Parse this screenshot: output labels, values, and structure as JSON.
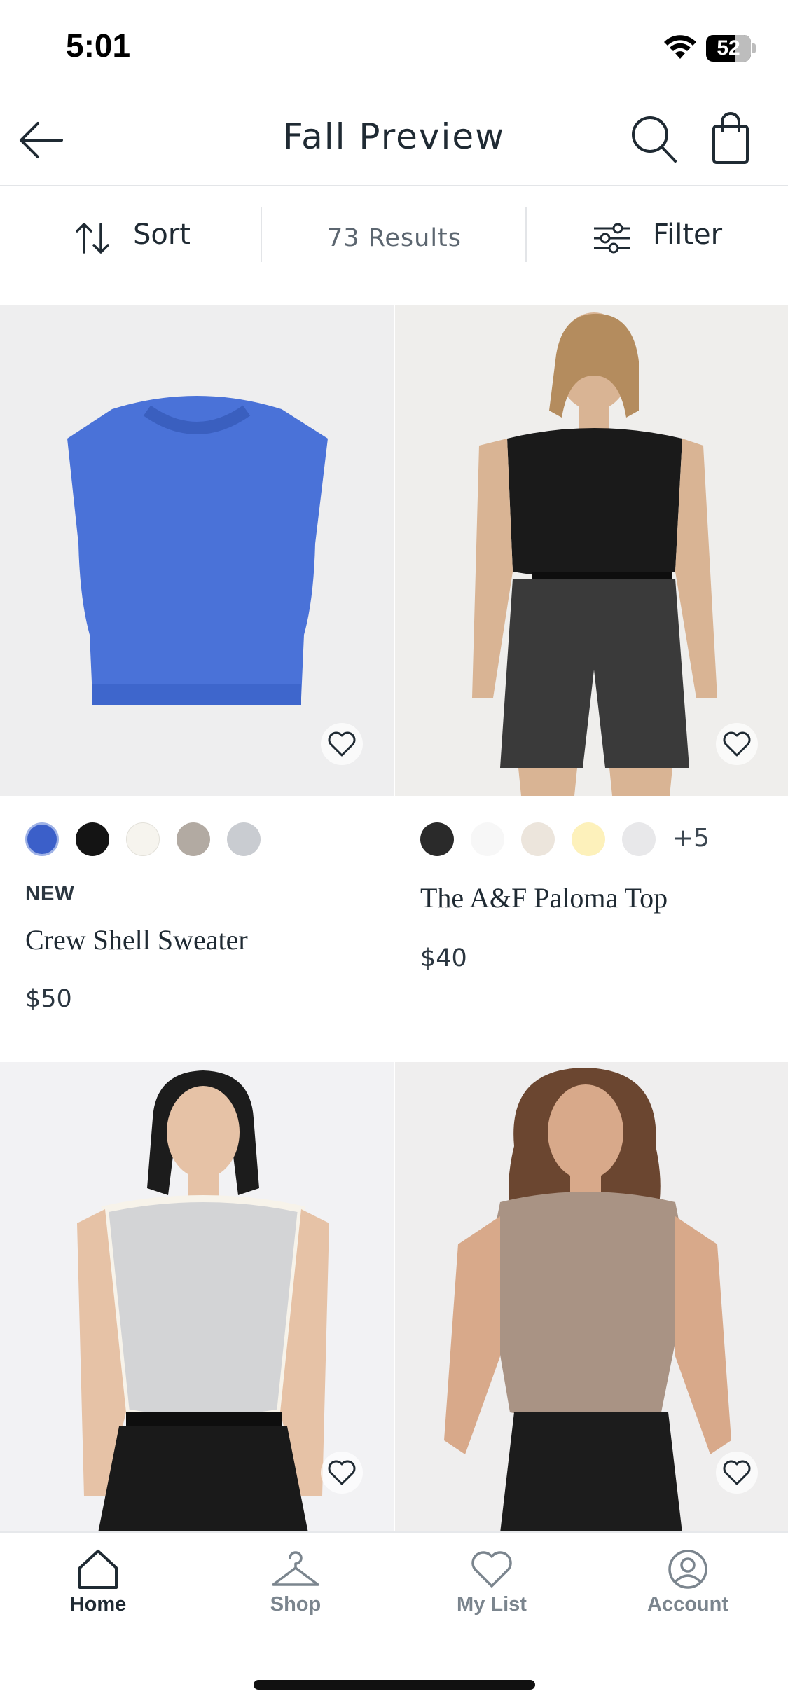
{
  "status_bar": {
    "time": "5:01",
    "battery_level": "52",
    "battery_fraction": 0.52
  },
  "header": {
    "title": "Fall Preview"
  },
  "toolbar": {
    "sort_label": "Sort",
    "results_label": "73 Results",
    "filter_label": "Filter"
  },
  "products": [
    {
      "badge": "NEW",
      "name": "Crew Shell Sweater",
      "price": "$50",
      "swatches": [
        "#3b5fc9",
        "#141414",
        "#f6f4ee",
        "#b2aaa2",
        "#c9ccd1"
      ],
      "more_colors": "",
      "image_bg": "#eeeeef",
      "garment_color": "#4a72d8"
    },
    {
      "badge": "",
      "name": "The A&F Paloma Top",
      "price": "$40",
      "swatches": [
        "#2a2a2a",
        "#f7f7f7",
        "#ece5dc",
        "#fdf1bb",
        "#e8e8ea"
      ],
      "more_colors": "+5",
      "image_bg": "#efeeec",
      "garment_color": "#1a1a1a"
    },
    {
      "badge": "",
      "name": "",
      "price": "",
      "swatches": [],
      "more_colors": "",
      "image_bg": "#f2f2f4",
      "garment_color": "#cfd0d2"
    },
    {
      "badge": "",
      "name": "",
      "price": "",
      "swatches": [],
      "more_colors": "",
      "image_bg": "#efeeee",
      "garment_color": "#a99384"
    }
  ],
  "tabbar": {
    "items": [
      {
        "label": "Home",
        "icon": "home-icon",
        "active": true
      },
      {
        "label": "Shop",
        "icon": "hanger-icon",
        "active": false
      },
      {
        "label": "My List",
        "icon": "heart-icon",
        "active": false
      },
      {
        "label": "Account",
        "icon": "account-icon",
        "active": false
      }
    ]
  },
  "colors": {
    "text": "#1f2a33",
    "muted": "#7b858e",
    "divider": "#e3e5e8"
  }
}
